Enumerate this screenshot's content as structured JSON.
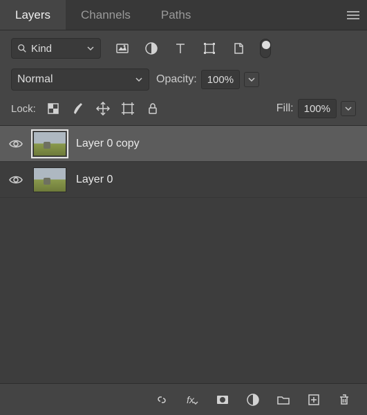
{
  "tabs": {
    "layers": "Layers",
    "channels": "Channels",
    "paths": "Paths"
  },
  "filter": {
    "kind_label": "Kind"
  },
  "blend": {
    "mode": "Normal",
    "opacity_label": "Opacity:",
    "opacity_value": "100%"
  },
  "lock": {
    "label": "Lock:"
  },
  "fill": {
    "label": "Fill:",
    "value": "100%"
  },
  "layers": [
    {
      "name": "Layer 0 copy",
      "visible": true,
      "selected": true
    },
    {
      "name": "Layer 0",
      "visible": true,
      "selected": false
    }
  ]
}
